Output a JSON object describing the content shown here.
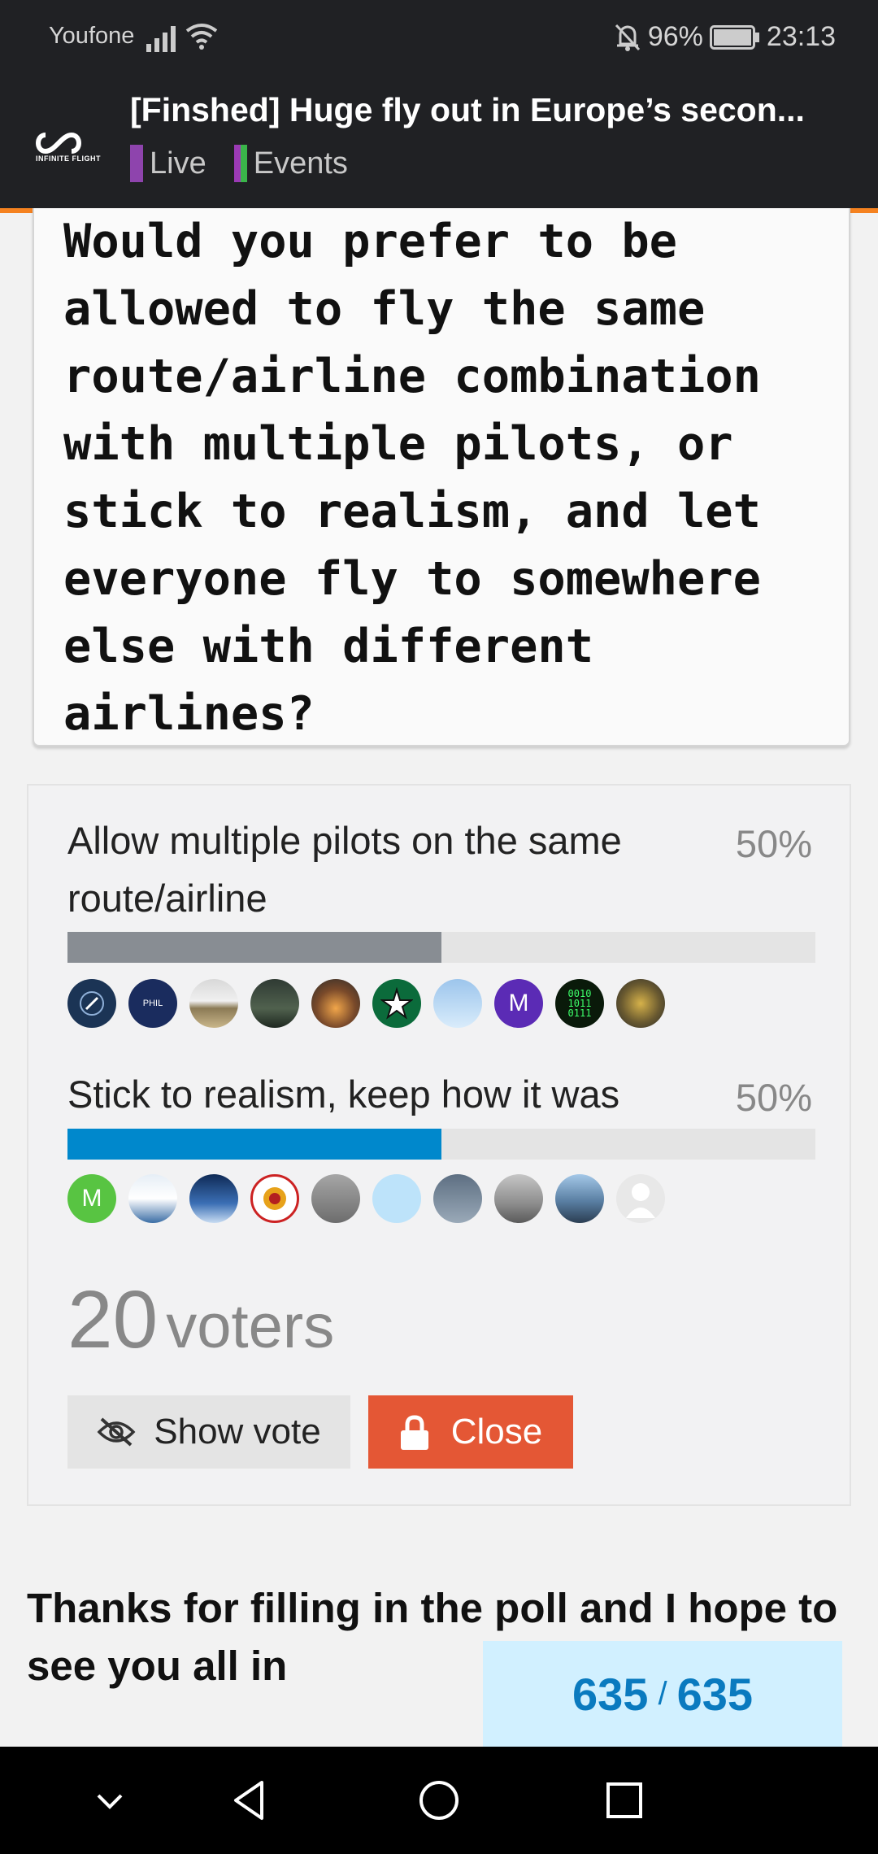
{
  "status_bar": {
    "carrier": "Youfone",
    "battery": "96%",
    "time": "23:13"
  },
  "header": {
    "logo_text": "INFINITE FLIGHT",
    "title": "[Finshed] Huge fly out in Europe’s secon...",
    "categories": [
      {
        "label": "Live",
        "color": "#8e44ad"
      },
      {
        "label": "Events",
        "color": "#9b3ab5"
      }
    ]
  },
  "question": "Would you prefer to be allowed to fly the same route/airline combination with multiple pilots, or stick to realism, and let everyone fly to somewhere else with different airlines?",
  "poll": {
    "options": [
      {
        "label": "Allow multiple pilots on the same route/airline",
        "percent": "50%",
        "fraction": 0.5,
        "color": "#888d93"
      },
      {
        "label": "Stick to realism, keep how it was",
        "percent": "50%",
        "fraction": 0.5,
        "color": "#0088cc"
      }
    ],
    "avatar_letters": {
      "opt1_m": "M",
      "opt2_m": "M"
    },
    "voter_count": "20",
    "voter_label": "voters",
    "show_vote_label": "Show vote",
    "close_label": "Close"
  },
  "post_text": "Thanks for filling in the poll and I hope to see you all in",
  "progress": {
    "current": "635",
    "sep": "/",
    "total": "635"
  }
}
